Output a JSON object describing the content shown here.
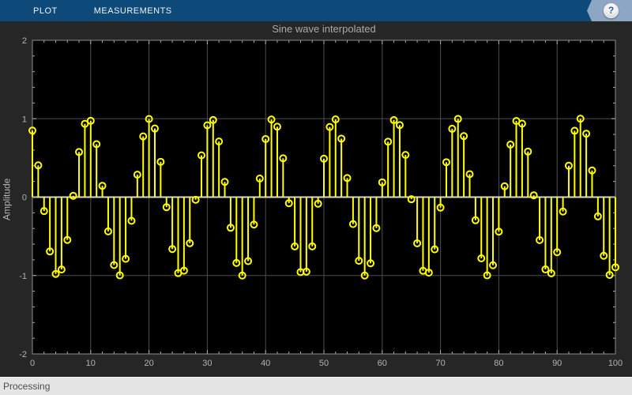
{
  "toolbar": {
    "tabs": [
      {
        "label": "PLOT"
      },
      {
        "label": "MEASUREMENTS"
      }
    ],
    "help_icon": "?"
  },
  "status_bar": {
    "text": "Processing"
  },
  "colors": {
    "toolbar_bg": "#0d4a7a",
    "window_bg": "#262626",
    "plot_bg": "#000000",
    "grid": "#4d4d4d",
    "baseline": "#d9d9d9",
    "box_border": "#8c8c8c",
    "tick": "#b0b0b0",
    "label": "#b3b3b3",
    "stem": "#ffff00",
    "status_bg": "#e5e5e5",
    "help_banner_bg": "#8ca6c4"
  },
  "chart_data": {
    "type": "stem",
    "title": "Sine wave interpolated",
    "xlabel": "",
    "ylabel": "Amplitude",
    "xlim": [
      0,
      100
    ],
    "ylim": [
      -2,
      2
    ],
    "x_major_ticks": [
      0,
      10,
      20,
      30,
      40,
      50,
      60,
      70,
      80,
      90,
      100
    ],
    "x_tick_labels": [
      "0",
      "10",
      "20",
      "30",
      "40",
      "50",
      "60",
      "70",
      "80",
      "90",
      "100"
    ],
    "x_minor_step": 2,
    "y_major_ticks": [
      -2,
      -1,
      0,
      1,
      2
    ],
    "y_tick_labels": [
      "-2",
      "-1",
      "0",
      "1",
      "2"
    ],
    "y_minor_step": 0.2,
    "grid": true,
    "legend": "none",
    "baseline": 0,
    "series_color": "#ffff00",
    "x_start": 0,
    "x_step": 1,
    "values": [
      0.849,
      0.405,
      -0.178,
      -0.693,
      -0.98,
      -0.923,
      -0.546,
      0.017,
      0.575,
      0.935,
      0.973,
      0.675,
      0.144,
      -0.437,
      -0.866,
      -0.998,
      -0.787,
      -0.302,
      0.286,
      0.774,
      0.996,
      0.875,
      0.45,
      -0.128,
      -0.662,
      -0.969,
      -0.938,
      -0.588,
      -0.034,
      0.533,
      0.916,
      0.983,
      0.709,
      0.194,
      -0.391,
      -0.84,
      -1.0,
      -0.816,
      -0.35,
      0.237,
      0.741,
      0.99,
      0.898,
      0.495,
      -0.078,
      -0.629,
      -0.956,
      -0.951,
      -0.628,
      -0.084,
      0.49,
      0.894,
      0.991,
      0.746,
      0.243,
      -0.344,
      -0.812,
      -1.0,
      -0.844,
      -0.395,
      0.188,
      0.707,
      0.982,
      0.918,
      0.538,
      -0.027,
      -0.589,
      -0.94,
      -0.963,
      -0.666,
      -0.134,
      0.445,
      0.871,
      0.997,
      0.778,
      0.292,
      -0.295,
      -0.781,
      -0.998,
      -0.869,
      -0.441,
      0.138,
      0.67,
      0.971,
      0.937,
      0.581,
      0.023,
      -0.548,
      -0.922,
      -0.972,
      -0.703,
      -0.184,
      0.4,
      0.846,
      1.0,
      0.809,
      0.34,
      -0.246,
      -0.748,
      -0.992,
      -0.895
    ]
  }
}
